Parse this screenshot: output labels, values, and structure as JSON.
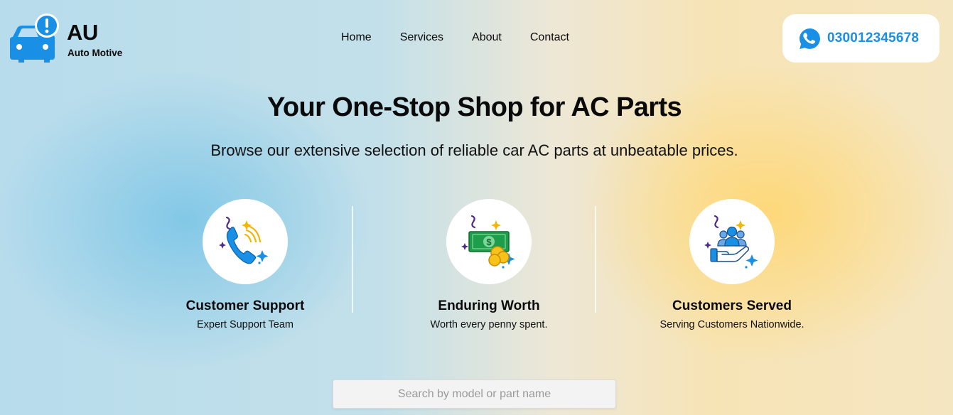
{
  "brand": {
    "title": "AU",
    "subtitle": "Auto Motive",
    "logo_icon": "car-alert-icon",
    "accent_color": "#1a8fe6"
  },
  "nav": {
    "items": [
      {
        "label": "Home"
      },
      {
        "label": "Services"
      },
      {
        "label": "About"
      },
      {
        "label": "Contact"
      }
    ]
  },
  "contact": {
    "icon": "whatsapp-icon",
    "phone": "03001234567​8"
  },
  "hero": {
    "title": "Your One-Stop Shop for AC Parts",
    "subtitle": "Browse our extensive selection of reliable car AC parts at unbeatable prices."
  },
  "features": [
    {
      "icon": "phone-support-icon",
      "title": "Customer Support",
      "description": "Expert Support Team"
    },
    {
      "icon": "money-coins-icon",
      "title": "Enduring Worth",
      "description": "Worth every penny spent."
    },
    {
      "icon": "customers-hand-icon",
      "title": "Customers Served",
      "description": "Serving Customers Nationwide."
    }
  ],
  "search": {
    "placeholder": "Search by model or part name",
    "value": ""
  }
}
